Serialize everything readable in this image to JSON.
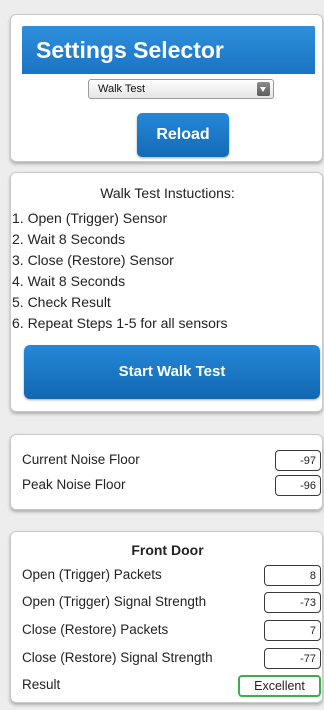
{
  "settings_selector": {
    "title": "Settings Selector",
    "dropdown_value": "Walk Test",
    "reload_label": "Reload"
  },
  "instructions": {
    "title": "Walk Test Instuctions:",
    "steps": [
      "1. Open (Trigger) Sensor",
      "2. Wait 8 Seconds",
      "3. Close (Restore) Sensor",
      "4. Wait 8 Seconds",
      "5. Check Result",
      "6. Repeat Steps 1-5 for all sensors"
    ],
    "start_label": "Start Walk Test"
  },
  "noise": {
    "current_label": "Current Noise Floor",
    "current_value": "-97",
    "peak_label": "Peak Noise Floor",
    "peak_value": "-96"
  },
  "sensor": {
    "name": "Front Door",
    "rows": [
      {
        "label": "Open (Trigger) Packets",
        "value": "8"
      },
      {
        "label": "Open (Trigger) Signal Strength",
        "value": "-73"
      },
      {
        "label": "Close (Restore) Packets",
        "value": "7"
      },
      {
        "label": "Close (Restore) Signal Strength",
        "value": "-77"
      }
    ],
    "result_label": "Result",
    "result_value": "Excellent"
  },
  "colors": {
    "accent_blue": "#1a74c3",
    "result_border_green": "#3fae49"
  },
  "icons": {
    "dropdown": "chevron-down-icon"
  }
}
